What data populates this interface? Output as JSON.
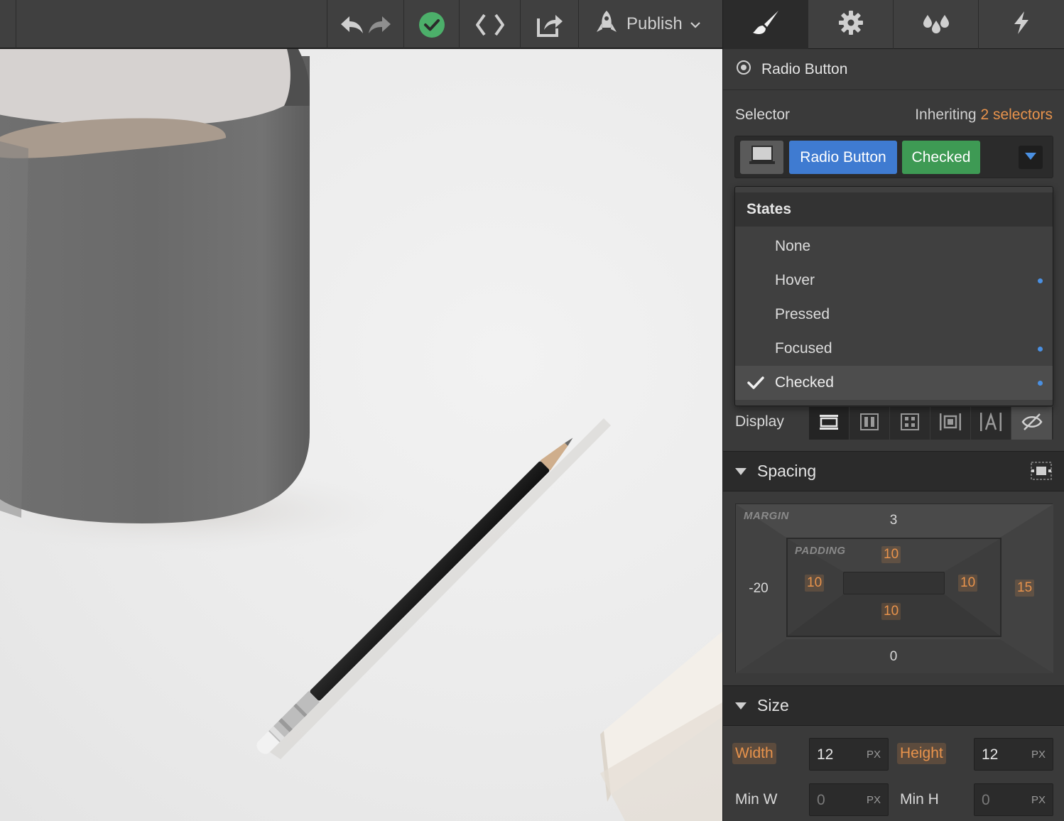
{
  "toolbar": {
    "publish_label": "Publish"
  },
  "panel": {
    "element_name": "Radio Button",
    "selector_label": "Selector",
    "inheriting_prefix": "Inheriting",
    "inheriting_link": "2 selectors",
    "chips": [
      "Radio Button",
      "Checked"
    ],
    "states": {
      "header": "States",
      "items": [
        {
          "label": "None",
          "has_dot": false
        },
        {
          "label": "Hover",
          "has_dot": true
        },
        {
          "label": "Pressed",
          "has_dot": false
        },
        {
          "label": "Focused",
          "has_dot": true
        },
        {
          "label": "Checked",
          "has_dot": true,
          "selected": true
        }
      ]
    },
    "display_label": "Display",
    "spacing": {
      "title": "Spacing",
      "margin_label": "MARGIN",
      "padding_label": "PADDING",
      "margin": {
        "top": "3",
        "right": "15",
        "bottom": "0",
        "left": "-20"
      },
      "padding": {
        "top": "10",
        "right": "10",
        "bottom": "10",
        "left": "10"
      }
    },
    "size": {
      "title": "Size",
      "width_label": "Width",
      "width_value": "12",
      "height_label": "Height",
      "height_value": "12",
      "min_w_label": "Min W",
      "min_w_value": "0",
      "min_h_label": "Min H",
      "min_h_value": "0",
      "unit": "PX"
    }
  },
  "colors": {
    "accent_blue": "#3f7bd1",
    "accent_green": "#3e9a54",
    "accent_orange": "#e8934c",
    "status_ok": "#4caf6a"
  }
}
